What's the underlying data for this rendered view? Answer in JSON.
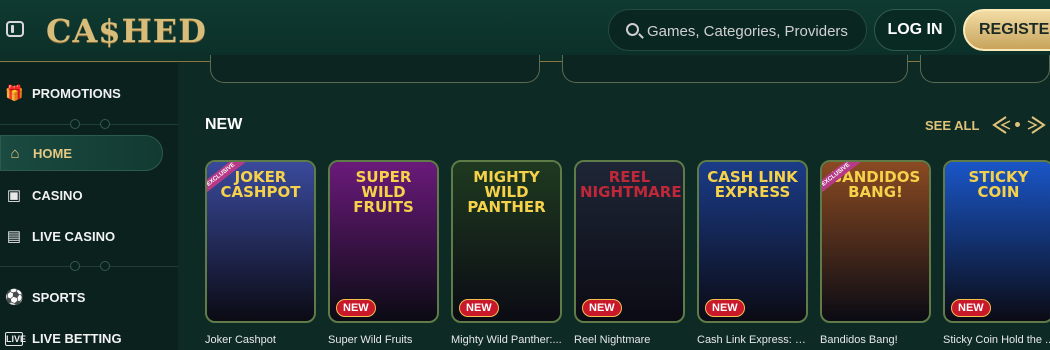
{
  "header": {
    "logo": "CA$HED",
    "search_placeholder": "Games, Categories, Providers",
    "login_label": "LOG IN",
    "register_label": "REGISTER"
  },
  "sidebar": {
    "items": [
      {
        "label": "PROMOTIONS",
        "icon": "gift-icon"
      },
      {
        "label": "HOME",
        "icon": "home-icon"
      },
      {
        "label": "CASINO",
        "icon": "slot-machine-icon"
      },
      {
        "label": "LIVE CASINO",
        "icon": "cards-icon"
      },
      {
        "label": "SPORTS",
        "icon": "soccer-ball-icon"
      },
      {
        "label": "LIVE BETTING",
        "icon": "live-icon"
      }
    ]
  },
  "section": {
    "title": "NEW",
    "see_all": "SEE ALL"
  },
  "games": [
    {
      "title": "Joker Cashpot",
      "art_text": "JOKER CASHPOT",
      "badge": "",
      "exclusive": "EXCLUSIVE",
      "bg": "#3a4a9c"
    },
    {
      "title": "Super Wild Fruits",
      "art_text": "SUPER WILD FRUITS",
      "badge": "NEW",
      "exclusive": "",
      "bg": "#6a1a7a"
    },
    {
      "title": "Mighty Wild Panther:...",
      "art_text": "MIGHTY WILD PANTHER",
      "badge": "NEW",
      "exclusive": "",
      "bg": "#1f3a20"
    },
    {
      "title": "Reel Nightmare",
      "art_text": "REEL NIGHTMARE",
      "badge": "NEW",
      "exclusive": "",
      "bg": "#1e2636"
    },
    {
      "title": "Cash Link Express: H...",
      "art_text": "CASH LINK EXPRESS",
      "badge": "NEW",
      "exclusive": "",
      "bg": "#1b3c88"
    },
    {
      "title": "Bandidos Bang!",
      "art_text": "BANDIDOS BANG!",
      "badge": "",
      "exclusive": "EXCLUSIVE",
      "bg": "#8a4a22"
    },
    {
      "title": "Sticky Coin Hold the ...",
      "art_text": "STICKY COIN",
      "badge": "NEW",
      "exclusive": "",
      "bg": "#1a56c8"
    }
  ]
}
